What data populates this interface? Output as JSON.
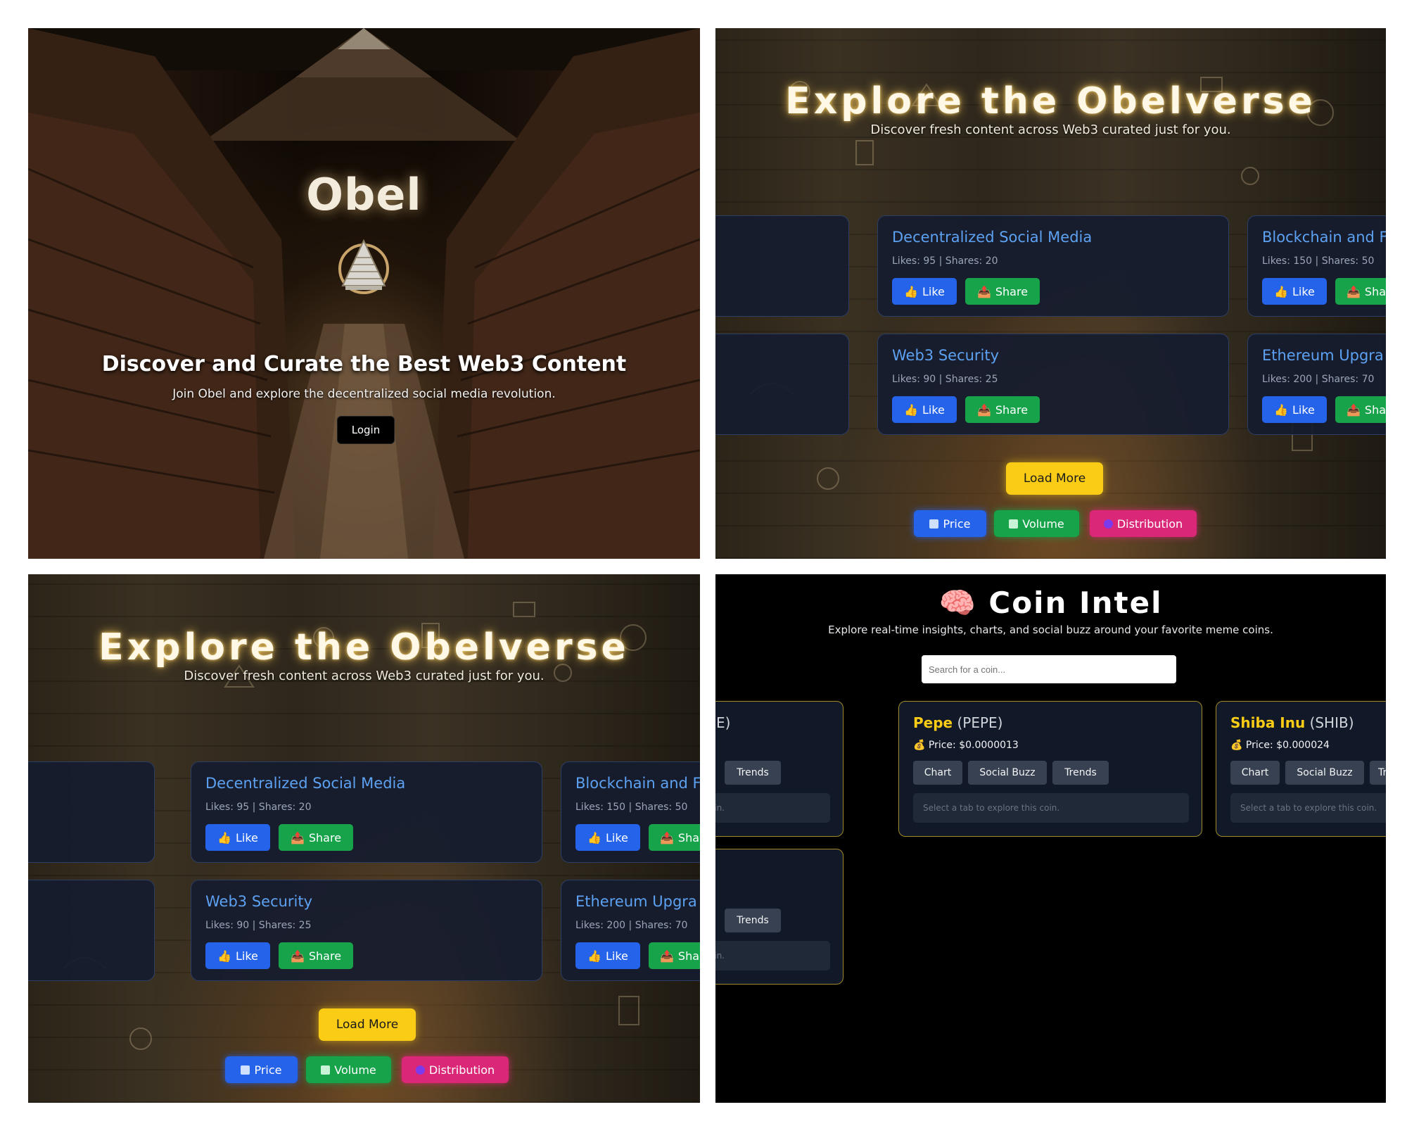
{
  "hero": {
    "title": "Obel",
    "headline": "Discover and Curate the Best Web3 Content",
    "subtitle": "Join Obel and explore the decentralized social media revolution.",
    "login_label": "Login"
  },
  "explore": {
    "title": "Explore the Obelverse",
    "subtitle": "Discover fresh content across Web3 curated just for you.",
    "cards": [
      {
        "title": "Decentralized Social Media",
        "meta": "Likes: 95 | Shares: 20"
      },
      {
        "title": "Blockchain and F",
        "meta": "Likes: 150 | Shares: 50"
      },
      {
        "title": "Web3 Security",
        "meta": "Likes: 90 | Shares: 25"
      },
      {
        "title": "Ethereum Upgra",
        "meta": "Likes: 200 | Shares: 70"
      }
    ],
    "like_label": "Like",
    "share_label": "Share",
    "share_label_clipped": "Sha",
    "load_more_label": "Load More",
    "tabs": {
      "price": "Price",
      "volume": "Volume",
      "distribution": "Distribution"
    }
  },
  "coin_intel": {
    "title": "Coin Intel",
    "emoji": "🧠",
    "subtitle": "Explore real-time insights, charts, and social buzz around your favorite meme coins.",
    "search_placeholder": "Search for a coin...",
    "left_card_fragment": "E)",
    "left_hint_fragment": "is coin.",
    "coins": [
      {
        "name": "Pepe",
        "symbol": "(PEPE)",
        "price": "Price: $0.0000013"
      },
      {
        "name": "Shiba Inu",
        "symbol": "(SHIB)",
        "price": "Price: $0.000024"
      }
    ],
    "tab_labels": {
      "chart": "Chart",
      "social_buzz": "Social Buzz",
      "trends": "Trends",
      "trends_clipped": "Tr"
    },
    "hint": "Select a tab to explore this coin."
  },
  "colors": {
    "like": "#2563eb",
    "share": "#16a34a",
    "load_more": "#facc15",
    "price_tab": "#2563eb",
    "volume_tab": "#16a34a",
    "distribution_tab": "#db2777",
    "card_title": "#5ca1f2",
    "coin_name": "#facc15"
  }
}
